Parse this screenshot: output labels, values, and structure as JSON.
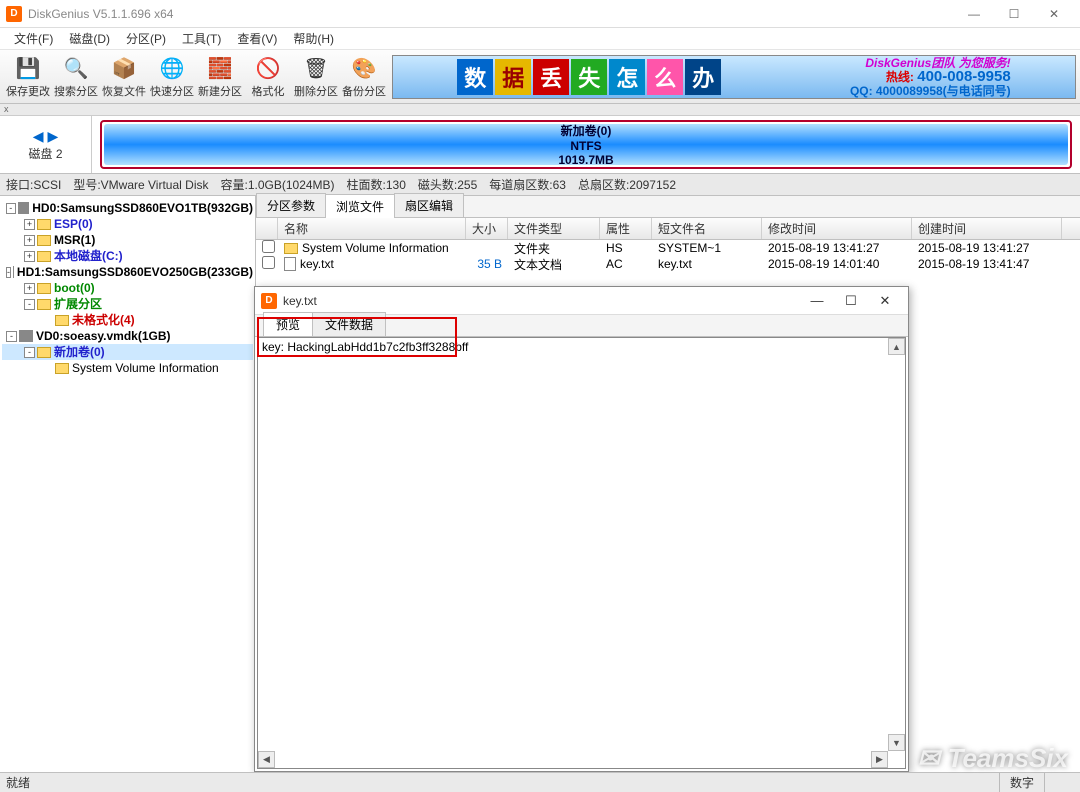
{
  "window": {
    "title": "DiskGenius V5.1.1.696 x64",
    "min": "—",
    "max": "☐",
    "close": "✕"
  },
  "menu": [
    "文件(F)",
    "磁盘(D)",
    "分区(P)",
    "工具(T)",
    "查看(V)",
    "帮助(H)"
  ],
  "toolbar": [
    {
      "label": "保存更改",
      "icon": "💾"
    },
    {
      "label": "搜索分区",
      "icon": "🔍"
    },
    {
      "label": "恢复文件",
      "icon": "📦"
    },
    {
      "label": "快速分区",
      "icon": "🌐"
    },
    {
      "label": "新建分区",
      "icon": "🧱"
    },
    {
      "label": "格式化",
      "icon": "🚫"
    },
    {
      "label": "删除分区",
      "icon": "🗑"
    },
    {
      "label": "备份分区",
      "icon": "🎨"
    }
  ],
  "banner": {
    "chars": [
      "数",
      "据",
      "丢",
      "失",
      "怎",
      "么",
      "办"
    ],
    "slogan": "DiskGenius团队 为您服务!",
    "hotline_label": "热线:",
    "hotline": "400-008-9958",
    "qq": "QQ: 4000089958(与电话同号)"
  },
  "disk_nav": {
    "arrows": "◀ ▶",
    "label": "磁盘 2"
  },
  "volume": {
    "name": "新加卷(0)",
    "fs": "NTFS",
    "size": "1019.7MB"
  },
  "infobar": {
    "if": "接口:SCSI",
    "model": "型号:VMware Virtual Disk",
    "cap": "容量:1.0GB(1024MB)",
    "cyl": "柱面数:130",
    "head": "磁头数:255",
    "spt": "每道扇区数:63",
    "total": "总扇区数:2097152"
  },
  "tree": [
    {
      "indent": 0,
      "ex": "-",
      "ico": "hd",
      "text": "HD0:SamsungSSD860EVO1TB(932GB)",
      "cls": "b black"
    },
    {
      "indent": 1,
      "ex": "+",
      "ico": "fd",
      "text": "ESP(0)",
      "cls": "b blue"
    },
    {
      "indent": 1,
      "ex": "+",
      "ico": "fd",
      "text": "MSR(1)",
      "cls": "b black"
    },
    {
      "indent": 1,
      "ex": "+",
      "ico": "fd",
      "text": "本地磁盘(C:)",
      "cls": "b blue"
    },
    {
      "indent": 0,
      "ex": "-",
      "ico": "hd",
      "text": "HD1:SamsungSSD860EVO250GB(233GB)",
      "cls": "b black"
    },
    {
      "indent": 1,
      "ex": "+",
      "ico": "fd",
      "text": "boot(0)",
      "cls": "b green"
    },
    {
      "indent": 1,
      "ex": "-",
      "ico": "fd",
      "text": "扩展分区",
      "cls": "b green"
    },
    {
      "indent": 2,
      "ex": "",
      "ico": "fd",
      "text": "未格式化(4)",
      "cls": "b red"
    },
    {
      "indent": 0,
      "ex": "-",
      "ico": "hd",
      "text": "VD0:soeasy.vmdk(1GB)",
      "cls": "b black"
    },
    {
      "indent": 1,
      "ex": "-",
      "ico": "fd",
      "text": "新加卷(0)",
      "cls": "b blue",
      "sel": true
    },
    {
      "indent": 2,
      "ex": "",
      "ico": "fd",
      "text": "System Volume Information",
      "cls": "black"
    }
  ],
  "tabs": [
    "分区参数",
    "浏览文件",
    "扇区编辑"
  ],
  "active_tab": 1,
  "columns": [
    {
      "label": "",
      "w": 22
    },
    {
      "label": "名称",
      "w": 188
    },
    {
      "label": "大小",
      "w": 42
    },
    {
      "label": "文件类型",
      "w": 92
    },
    {
      "label": "属性",
      "w": 52
    },
    {
      "label": "短文件名",
      "w": 110
    },
    {
      "label": "修改时间",
      "w": 150
    },
    {
      "label": "创建时间",
      "w": 150
    }
  ],
  "files": [
    {
      "ico": "fd",
      "name": "System Volume Information",
      "nameCls": "blue",
      "size": "",
      "type": "文件夹",
      "attr": "HS",
      "short": "SYSTEM~1",
      "mtime": "2015-08-19 13:41:27",
      "ctime": "2015-08-19 13:41:27"
    },
    {
      "ico": "fi",
      "name": "key.txt",
      "nameCls": "blue",
      "size": "35 B",
      "type": "文本文档",
      "attr": "AC",
      "short": "key.txt",
      "mtime": "2015-08-19 14:01:40",
      "ctime": "2015-08-19 13:41:47"
    }
  ],
  "preview": {
    "title": "key.txt",
    "tabs": [
      "预览",
      "文件数据"
    ],
    "content": "key: HackingLabHdd1b7c2fb3ff3288bff"
  },
  "status": {
    "ready": "就绪",
    "num": "数字"
  },
  "watermark": "TeamsSix",
  "close_x": "x"
}
